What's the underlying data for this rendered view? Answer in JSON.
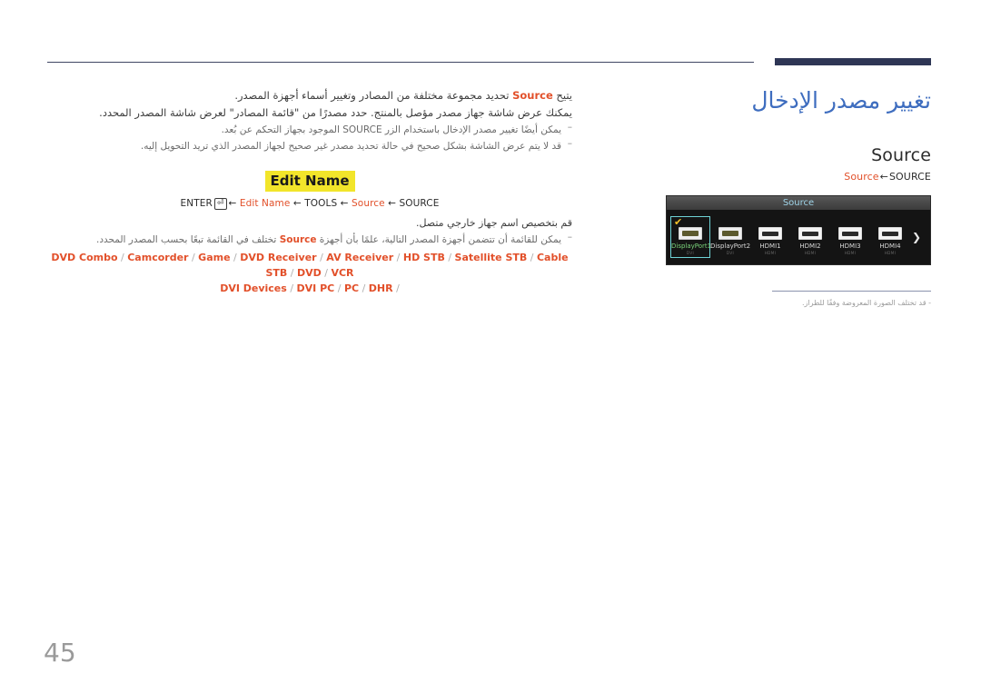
{
  "page": {
    "number": "45",
    "title": "تغيير مصدر الإدخال"
  },
  "right_panel": {
    "heading": "Source",
    "path": {
      "leaf": "Source",
      "arrow": "←",
      "root": "SOURCE"
    },
    "osd": {
      "title": "Source",
      "next_arrow": "❯",
      "check_glyph": "✔",
      "sources": [
        {
          "label": "DisplayPort1",
          "sub": "DVI",
          "port": "dp",
          "selected": true
        },
        {
          "label": "DisplayPort2",
          "sub": "DVI",
          "port": "dp",
          "selected": false
        },
        {
          "label": "HDMI1",
          "sub": "HDMI",
          "port": "hdmi",
          "selected": false
        },
        {
          "label": "HDMI2",
          "sub": "HDMI",
          "port": "hdmi",
          "selected": false
        },
        {
          "label": "HDMI3",
          "sub": "HDMI",
          "port": "hdmi",
          "selected": false
        },
        {
          "label": "HDMI4",
          "sub": "HDMI",
          "port": "hdmi",
          "selected": false
        }
      ]
    },
    "note": "- قد تختلف الصورة المعروضة وفقًا للطراز."
  },
  "main": {
    "intro_before": "يتيح ",
    "intro_src": "Source",
    "intro_after": " تحديد مجموعة مختلفة من المصادر وتغيير أسماء أجهزة المصدر.",
    "paragraph2": "يمكنك عرض شاشة جهاز مصدر مؤصل بالمنتج. حدد مصدرًا من \"قائمة المصادر\" لعرض شاشة المصدر المحدد.",
    "bullet1_before": "يمكن أيضًا تغيير مصدر الإدخال باستخدام الزر ",
    "bullet1_key": "SOURCE",
    "bullet1_after": " الموجود بجهاز التحكم عن بُعد.",
    "bullet2": "قد لا يتم عرض الشاشة بشكل صحيح في حالة تحديد مصدر غير صحيح لجهاز المصدر الذي تريد التحويل إليه.",
    "editname_badge": "Edit Name",
    "editname_path": {
      "enter": "ENTER",
      "enter_icon": "⏎",
      "arrow": "←",
      "step1": "Edit Name",
      "step2": "TOOLS",
      "step3": "Source",
      "step4": "SOURCE"
    },
    "paragraph3": "قم بتخصيص اسم جهاز خارجي متصل.",
    "bullet3_before": "يمكن للقائمة أن تتضمن أجهزة المصدر التالية، علمًا بأن أجهزة ",
    "bullet3_src": "Source",
    "bullet3_after": " تختلف في القائمة تبعًا بحسب المصدر المحدد.",
    "devices_line1": [
      "DVD Combo",
      "Camcorder",
      "Game",
      "DVD Receiver",
      "AV Receiver",
      "HD STB",
      "Satellite STB",
      "Cable STB",
      "DVD",
      "VCR"
    ],
    "devices_line2": [
      "DVI Devices",
      "DVI PC",
      "PC",
      "DHR"
    ]
  }
}
